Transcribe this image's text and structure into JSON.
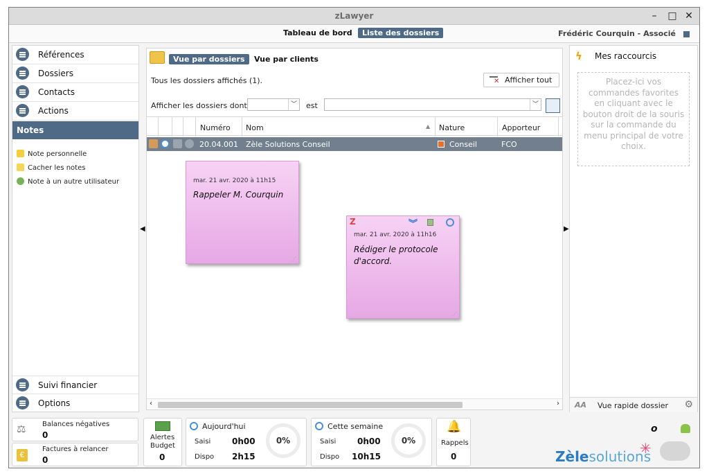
{
  "window": {
    "title": "zLawyer"
  },
  "topnav": {
    "tab1": "Tableau de bord",
    "tab2": "Liste des dossiers",
    "user": "Frédéric Courquin - Associé"
  },
  "leftnav": {
    "items": [
      "Références",
      "Dossiers",
      "Contacts",
      "Actions"
    ],
    "notes_header": "Notes",
    "notes_items": [
      "Note personnelle",
      "Cacher les notes",
      "Note à un autre utilisateur"
    ],
    "bottom_items": [
      "Suivi financier",
      "Options"
    ]
  },
  "center": {
    "view_tab_active": "Vue par dossiers",
    "view_tab": "Vue par clients",
    "info": "Tous les dossiers affichés (1).",
    "show_all": "Afficher tout",
    "filter_label": "Afficher les dossiers dont",
    "filter_est": "est",
    "columns": [
      "Numéro",
      "Nom",
      "Nature",
      "Apporteur"
    ],
    "rows": [
      {
        "numero": "20.04.001",
        "nom": "Zèle Solutions Conseil",
        "nature": "Conseil",
        "apporteur": "FCO"
      }
    ]
  },
  "notes": [
    {
      "date": "mar. 21 avr. 2020 à 11h15",
      "text": "Rappeler M. Courquin"
    },
    {
      "date": "mar. 21 avr. 2020 à 11h16",
      "text": "Rédiger le protocole d'accord."
    }
  ],
  "right": {
    "title": "Mes raccourcis",
    "dropzone": "Placez-ici vos commandes favorites en cliquant avec le bouton droit de la souris sur la commande du menu principal de votre choix.",
    "footer_aa": "AA",
    "footer_label": "Vue rapide dossier"
  },
  "bottom": {
    "balances_label": "Balances négatives",
    "balances_value": "0",
    "factures_label": "Factures à relancer",
    "factures_value": "0",
    "alertes_label1": "Alertes",
    "alertes_label2": "Budget",
    "alertes_value": "0",
    "today_title": "Aujourd'hui",
    "today_saisi_label": "Saisi",
    "today_saisi": "0h00",
    "today_dispo_label": "Dispo",
    "today_dispo": "2h15",
    "today_pct": "0%",
    "week_title": "Cette semaine",
    "week_saisi_label": "Saisi",
    "week_saisi": "0h00",
    "week_dispo_label": "Dispo",
    "week_dispo": "10h15",
    "week_pct": "0%",
    "rappels_label": "Rappels",
    "rappels_value": "0",
    "brand1": "Zèle",
    "brand2": "solutions"
  },
  "colors": {
    "accent": "#4e6a86",
    "note": "#efbdec",
    "nature": "#e96d2b"
  }
}
